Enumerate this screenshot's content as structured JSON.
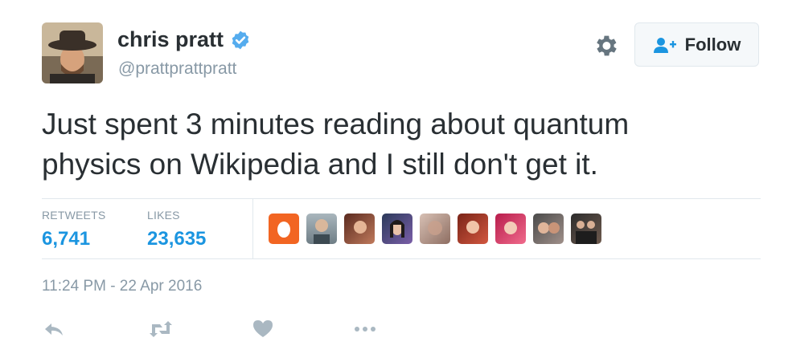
{
  "user": {
    "display_name": "chris pratt",
    "handle": "@prattprattpratt",
    "verified": true
  },
  "follow_label": "Follow",
  "tweet": {
    "line1": "Just spent 3 minutes reading about quantum",
    "line2": "physics on Wikipedia and I still don't get it."
  },
  "stats": {
    "retweets_label": "RETWEETS",
    "retweets": "6,741",
    "likes_label": "LIKES",
    "likes": "23,635"
  },
  "timestamp": "11:24 PM - 22 Apr 2016",
  "colors": {
    "link_blue": "#1b95e0",
    "verified_blue": "#55acee",
    "muted_gray": "#8899a6",
    "text_dark": "#292f33"
  },
  "icons": [
    "gear-icon",
    "follow-user-icon",
    "reply-icon",
    "retweet-icon",
    "like-heart-icon",
    "more-icon"
  ]
}
